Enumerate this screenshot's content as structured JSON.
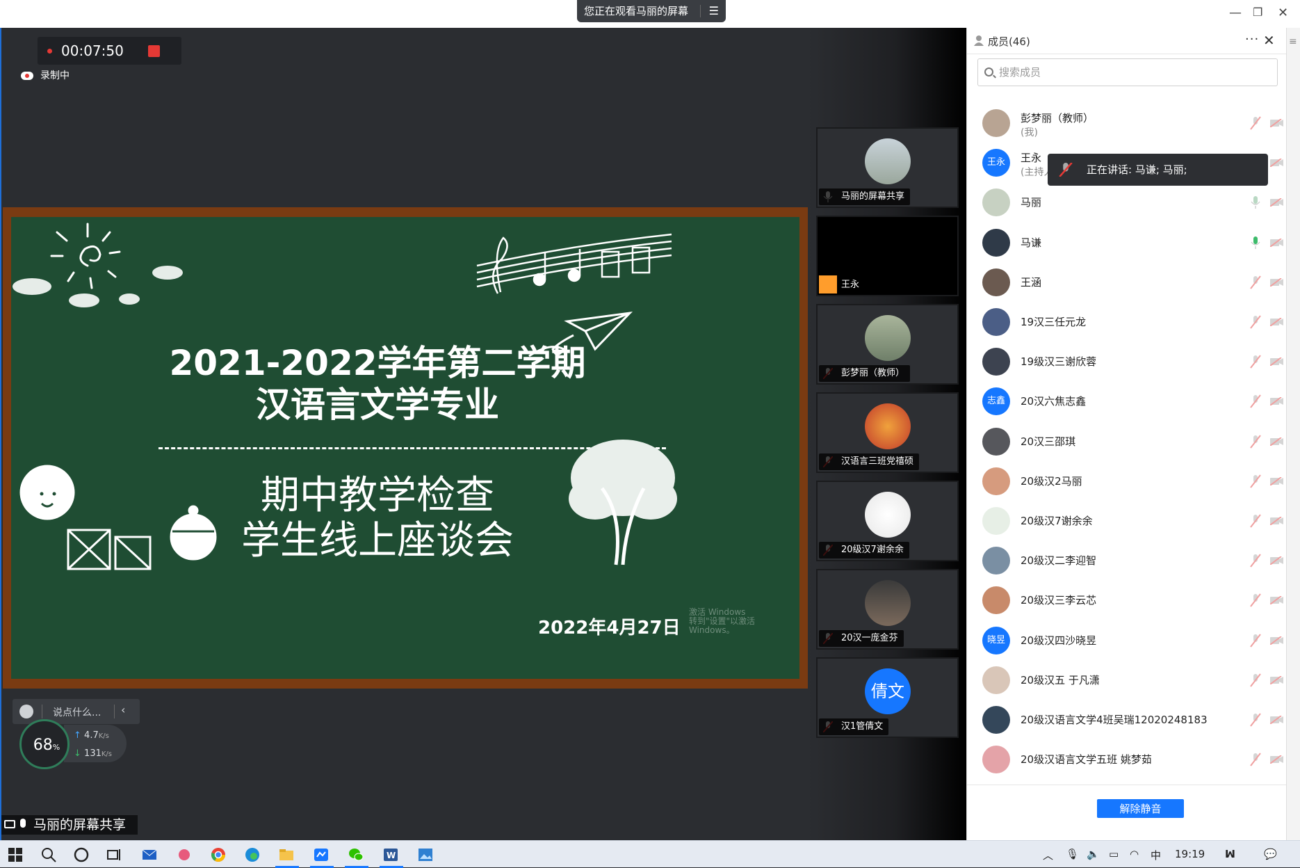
{
  "titlebar": {
    "viewing_text": "您正在观看马丽的屏幕",
    "menu_icon": "menu-icon",
    "controls": [
      "—",
      "❐",
      "✕"
    ]
  },
  "recording": {
    "timer": "00:07:50",
    "status": "录制中"
  },
  "slide": {
    "line1": "2021-2022学年第二学期",
    "line2": "汉语言文学专业",
    "line3": "期中教学检查",
    "line4": "学生线上座谈会",
    "date": "2022年4月27日",
    "watermark_l1": "激活 Windows",
    "watermark_l2": "转到\"设置\"以激活Windows。"
  },
  "chat": {
    "placeholder": "说点什么...",
    "collapse": "‹"
  },
  "network": {
    "quality": "68",
    "unit": "%",
    "up": "4.7",
    "down": "131",
    "rate_unit": "K/s"
  },
  "share_label": "马丽的屏幕共享",
  "video_tiles": [
    {
      "name": "马丽的屏幕共享"
    },
    {
      "name": "王永"
    },
    {
      "name": "彭梦丽（教师）"
    },
    {
      "name": "汉语言三班党禧硕"
    },
    {
      "name": "20级汉7谢余余"
    },
    {
      "name": "20汉一庞金芬"
    },
    {
      "name": "汉1管倩文",
      "avatar_text": "倩文"
    }
  ],
  "members_panel": {
    "title": "成员(46)",
    "more": "···",
    "close": "✕",
    "search_placeholder": "搜索成员",
    "tooltip": "正在讲话: 马谦; 马丽;",
    "unmute_button": "解除静音",
    "members": [
      {
        "name": "彭梦丽（教师）",
        "sub": "(我)"
      },
      {
        "name": "王永",
        "sub": "(主持人)",
        "avatar_text": "王永"
      },
      {
        "name": "马丽"
      },
      {
        "name": "马谦"
      },
      {
        "name": " 王涵"
      },
      {
        "name": "19汉三任元龙"
      },
      {
        "name": "19级汉三谢欣蓉"
      },
      {
        "name": "20汉六焦志鑫",
        "avatar_text": "志鑫"
      },
      {
        "name": "20汉三邵琪"
      },
      {
        "name": "20级汉2马丽"
      },
      {
        "name": "20级汉7谢余余"
      },
      {
        "name": "20级汉二李迎智"
      },
      {
        "name": "20级汉三李云芯"
      },
      {
        "name": "20级汉四沙晓昱",
        "avatar_text": "晓昱"
      },
      {
        "name": "20级汉五 于凡潇"
      },
      {
        "name": "20级汉语言文学4班吴瑞12020248183"
      },
      {
        "name": "20级汉语言文学五班 姚梦茹"
      }
    ]
  },
  "taskbar": {
    "ime": "中",
    "clock": "19:19"
  },
  "colors": {
    "accent": "#1677ff",
    "board": "#1f4d33",
    "record": "#e53935"
  }
}
